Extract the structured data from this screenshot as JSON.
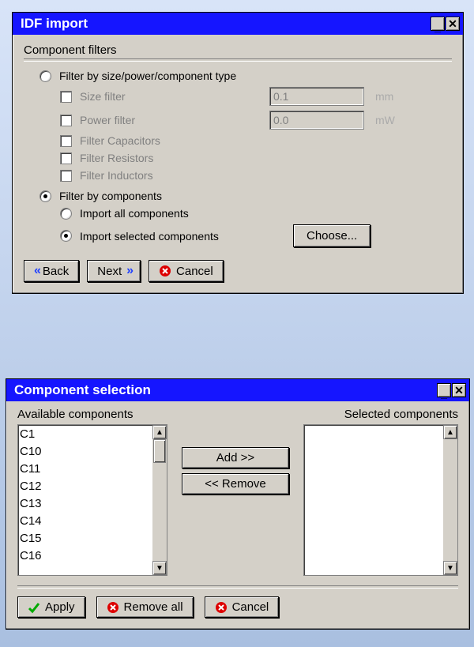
{
  "idf_window": {
    "title": "IDF import",
    "group": "Component filters",
    "radio_size_power": "Filter by size/power/component type",
    "cb_size": "Size filter",
    "cb_power": "Power filter",
    "cb_cap": "Filter Capacitors",
    "cb_res": "Filter Resistors",
    "cb_ind": "Filter Inductors",
    "size_val": "0.1",
    "size_unit": "mm",
    "power_val": "0.0",
    "power_unit": "mW",
    "radio_components": "Filter by components",
    "radio_import_all": "Import all components",
    "radio_import_sel": "Import selected components",
    "choose": "Choose...",
    "back": "Back",
    "next": "Next",
    "cancel": "Cancel"
  },
  "comp_window": {
    "title": "Component selection",
    "avail_label": "Available components",
    "sel_label": "Selected components",
    "add": "Add >>",
    "remove": "<< Remove",
    "apply": "Apply",
    "remove_all": "Remove all",
    "cancel": "Cancel",
    "available": [
      "C1",
      "C10",
      "C11",
      "C12",
      "C13",
      "C14",
      "C15",
      "C16"
    ],
    "selected": []
  }
}
